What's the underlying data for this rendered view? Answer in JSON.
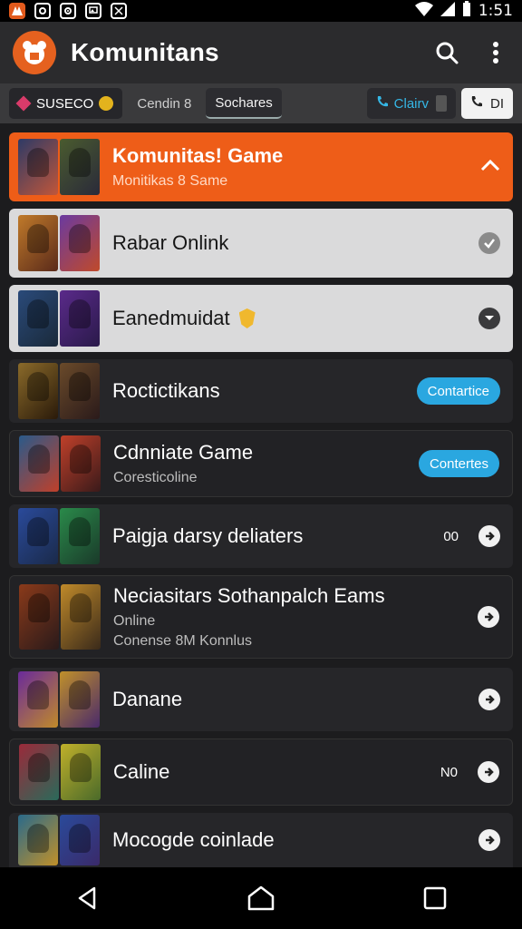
{
  "status_bar": {
    "time": "1:51"
  },
  "app_bar": {
    "title": "Komunitans",
    "logo_color": "#e5611f"
  },
  "tabs": {
    "brand": "SUSECO",
    "tab1": "Cendin 8",
    "tab2": "Sochares",
    "call1": "Clairv",
    "call2": "DI"
  },
  "colors": {
    "accent_orange": "#ee5d18",
    "accent_blue": "#2aa7e0"
  },
  "items": [
    {
      "title": "Komunitas! Game",
      "subtitle": "Monitikas 8 Same"
    },
    {
      "title": "Rabar Onlink"
    },
    {
      "title": "Eanedmuidat"
    },
    {
      "title": "Roctictikans",
      "action": "Contartice"
    },
    {
      "title": "Cdnniate Game",
      "subtitle": "Coresticoline",
      "action": "Contertes"
    },
    {
      "title": "Paigja darsy deliaters",
      "count": "00"
    },
    {
      "title": "Neciasitars Sothanpalch Eams",
      "subtitle": "Online",
      "subtitle2": "Conense 8M Konnlus"
    },
    {
      "title": "Danane"
    },
    {
      "title": "Caline",
      "count": "N0"
    },
    {
      "title": "Mocogde coinlade"
    }
  ]
}
